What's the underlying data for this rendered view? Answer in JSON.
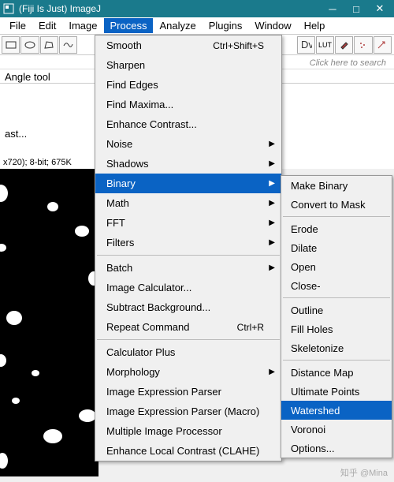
{
  "titlebar": {
    "title": "(Fiji Is Just) ImageJ"
  },
  "menubar": {
    "items": [
      "File",
      "Edit",
      "Image",
      "Process",
      "Analyze",
      "Plugins",
      "Window",
      "Help"
    ],
    "active_index": 3
  },
  "toolbar": {
    "lut_label": "LUT",
    "search_hint": "Click here to search"
  },
  "status": {
    "text": "Angle tool"
  },
  "mid": {
    "text": "ast..."
  },
  "image_info": {
    "text": "x720); 8-bit; 675K"
  },
  "process_menu": {
    "items": [
      {
        "label": "Smooth",
        "shortcut": "Ctrl+Shift+S"
      },
      {
        "label": "Sharpen"
      },
      {
        "label": "Find Edges"
      },
      {
        "label": "Find Maxima..."
      },
      {
        "label": "Enhance Contrast..."
      },
      {
        "label": "Noise",
        "arrow": true
      },
      {
        "label": "Shadows",
        "arrow": true
      },
      {
        "label": "Binary",
        "arrow": true,
        "highlight": true
      },
      {
        "label": "Math",
        "arrow": true
      },
      {
        "label": "FFT",
        "arrow": true
      },
      {
        "label": "Filters",
        "arrow": true
      },
      {
        "sep": true
      },
      {
        "label": "Batch",
        "arrow": true
      },
      {
        "label": "Image Calculator..."
      },
      {
        "label": "Subtract Background..."
      },
      {
        "label": "Repeat Command",
        "shortcut": "Ctrl+R"
      },
      {
        "sep": true
      },
      {
        "label": "Calculator Plus"
      },
      {
        "label": "Morphology",
        "arrow": true
      },
      {
        "label": "Image Expression Parser"
      },
      {
        "label": "Image Expression Parser (Macro)"
      },
      {
        "label": "Multiple Image Processor"
      },
      {
        "label": "Enhance Local Contrast (CLAHE)"
      }
    ]
  },
  "binary_submenu": {
    "items": [
      {
        "label": "Make Binary"
      },
      {
        "label": "Convert to Mask"
      },
      {
        "sep": true
      },
      {
        "label": "Erode"
      },
      {
        "label": "Dilate"
      },
      {
        "label": "Open"
      },
      {
        "label": "Close-"
      },
      {
        "sep": true
      },
      {
        "label": "Outline"
      },
      {
        "label": "Fill Holes"
      },
      {
        "label": "Skeletonize"
      },
      {
        "sep": true
      },
      {
        "label": "Distance Map"
      },
      {
        "label": "Ultimate Points"
      },
      {
        "label": "Watershed",
        "highlight": true
      },
      {
        "label": "Voronoi"
      },
      {
        "label": "Options..."
      }
    ]
  },
  "watermark": {
    "text": "知乎 @Mina"
  }
}
